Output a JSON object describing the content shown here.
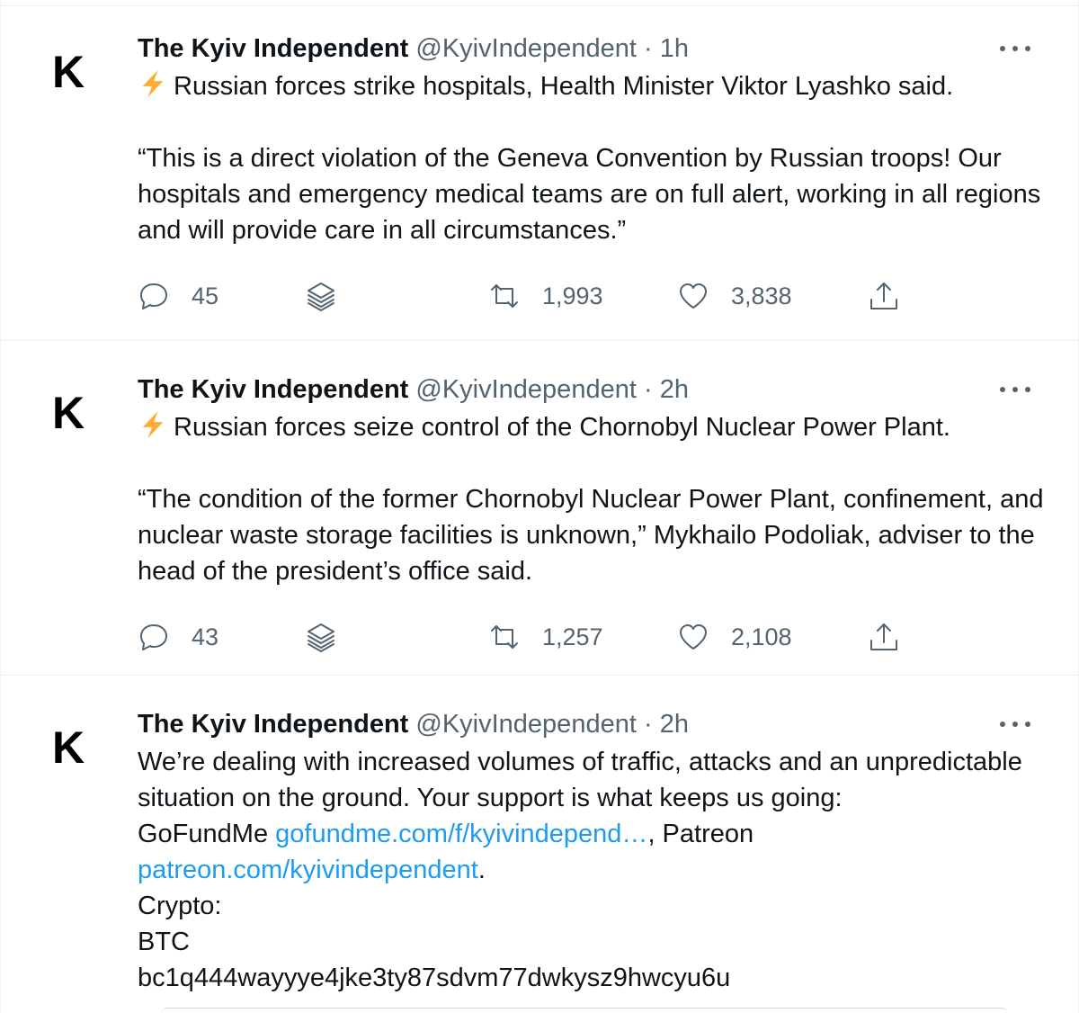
{
  "tweets": [
    {
      "avatar_letter": "K",
      "name": "The Kyiv Independent",
      "handle": "@KyivIndependent",
      "separator": "·",
      "time": "1h",
      "has_bolt": true,
      "paragraphs": [
        "Russian forces strike hospitals, Health Minister Viktor Lyashko said.",
        "“This is a direct violation of the Geneva Convention by Russian troops! Our hospitals and emergency medical teams are on full alert, working in all regions and will provide care in all circumstances.”"
      ],
      "replies": "45",
      "retweets": "1,993",
      "likes": "3,838"
    },
    {
      "avatar_letter": "K",
      "name": "The Kyiv Independent",
      "handle": "@KyivIndependent",
      "separator": "·",
      "time": "2h",
      "has_bolt": true,
      "paragraphs": [
        "Russian forces seize control of the Chornobyl Nuclear Power Plant.",
        "“The condition of the former Chornobyl Nuclear Power Plant, confinement, and nuclear waste storage facilities is unknown,” Mykhailo Podoliak, adviser to the head of the president’s office said."
      ],
      "replies": "43",
      "retweets": "1,257",
      "likes": "2,108"
    },
    {
      "avatar_letter": "K",
      "name": "The Kyiv Independent",
      "handle": "@KyivIndependent",
      "separator": "·",
      "time": "2h",
      "has_bolt": false,
      "intro": "We’re dealing with increased volumes of traffic, attacks and an unpredictable situation on the ground. Your support is what keeps us going:",
      "gofundme_label": "GoFundMe ",
      "gofundme_link": "gofundme.com/f/kyivindepend…",
      "patreon_sep": ",  Patreon",
      "patreon_link": "patreon.com/kyivindependent",
      "patreon_end": ".",
      "crypto_label": "Crypto:",
      "btc_label": "BTC",
      "btc_address": "bc1q444wayyye4jke3ty87sdvm77dwkysz9hwcyu6u"
    }
  ],
  "colors": {
    "text": "#0f1419",
    "secondary": "#536471",
    "link": "#1d9bf0",
    "bolt": "#ffac33",
    "divider": "#eff3f4"
  },
  "icons": {
    "reply": "speech-bubble-icon",
    "stack": "layers-icon",
    "retweet": "retweet-icon",
    "like": "heart-icon",
    "share": "share-upload-icon",
    "more": "three-dots-icon",
    "bolt": "lightning-bolt-emoji"
  }
}
